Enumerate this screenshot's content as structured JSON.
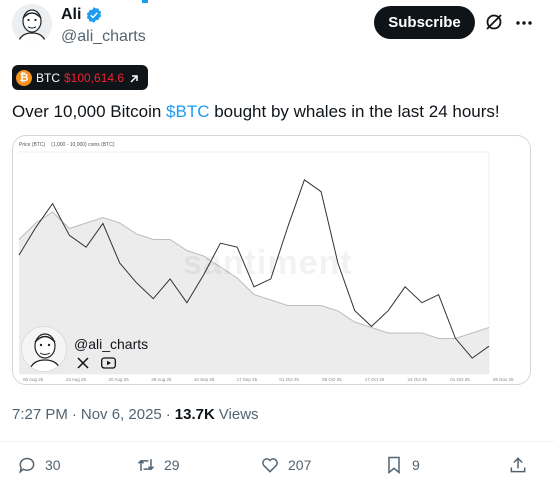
{
  "author": {
    "display_name": "Ali",
    "handle": "@ali_charts",
    "verified": true
  },
  "actions_top": {
    "subscribe_label": "Subscribe",
    "grok_icon": "grok-icon",
    "more_icon": "more-icon"
  },
  "ticker": {
    "symbol": "BTC",
    "price": "$100,614.6",
    "icon": "bitcoin-icon",
    "accent": "#f4212e"
  },
  "tweet": {
    "text_before": "Over 10,000 Bitcoin ",
    "cashtag": "$BTC",
    "text_after": " bought by whales in the last 24 hours!"
  },
  "media": {
    "watermark_handle": "@ali_charts",
    "watermark_brand": "santiment",
    "legend": [
      "Price (BTC)",
      "(1,000 - 10,000) coins (BTC)"
    ]
  },
  "chart_data": {
    "type": "line",
    "x_ticks": [
      "06 Aug 25",
      "13 Aug 25",
      "20 Aug 25",
      "28 Aug 25",
      "10 Sep 25",
      "17 Sep 25",
      "01 Oct 25",
      "09 Oct 25",
      "17 Oct 25",
      "24 Oct 25",
      "01 Oct 25",
      "06 Nov 25"
    ],
    "series": [
      {
        "name": "Price (BTC)",
        "color": "#333333",
        "values": [
          114500,
          118000,
          121000,
          117000,
          115500,
          118500,
          113500,
          111000,
          109000,
          111500,
          108500,
          112000,
          116000,
          115500,
          110500,
          111500,
          118000,
          124000,
          122500,
          113500,
          107500,
          105500,
          107500,
          110500,
          108500,
          109500,
          104000,
          101500,
          103000
        ]
      },
      {
        "name": "(1,000 - 10,000) coins (BTC)",
        "color": "#bdbdbd",
        "values": [
          73,
          76,
          78,
          75,
          76,
          77,
          76,
          74,
          73,
          73,
          71,
          70,
          68,
          66,
          63,
          62,
          61,
          61,
          61,
          60,
          58,
          57,
          56,
          56,
          56,
          55,
          55,
          56,
          57
        ]
      }
    ]
  },
  "meta": {
    "time": "7:27 PM",
    "separator": "·",
    "date": "Nov 6, 2025",
    "views_count": "13.7K",
    "views_label": "Views"
  },
  "engagement": {
    "replies": "30",
    "reposts": "29",
    "likes": "207",
    "bookmarks": "9"
  },
  "colors": {
    "link": "#1d9bf0",
    "muted": "#536471",
    "bitcoin": "#f7931a"
  }
}
